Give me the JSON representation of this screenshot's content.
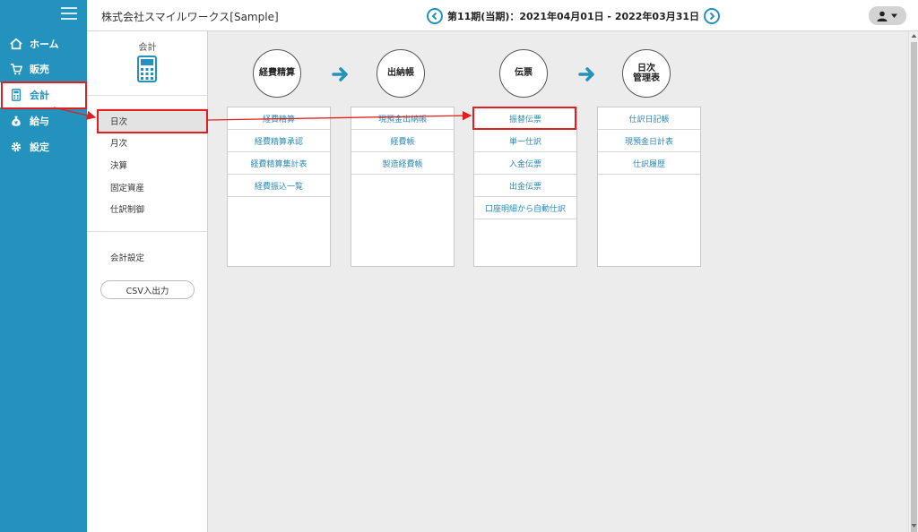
{
  "leftnav": {
    "items": [
      {
        "label": "ホーム",
        "icon": "home-icon"
      },
      {
        "label": "販売",
        "icon": "cart-icon"
      },
      {
        "label": "会計",
        "icon": "calculator-icon"
      },
      {
        "label": "給与",
        "icon": "money-bag-icon"
      },
      {
        "label": "設定",
        "icon": "gear-icon"
      }
    ],
    "active_index": 2
  },
  "header": {
    "company": "株式会社スマイルワークス[Sample]",
    "period": "第11期(当期)：2021年04月01日 - 2022年03月31日",
    "user_icon": "user-icon"
  },
  "submenu": {
    "title": "会計",
    "items": [
      "日次",
      "月次",
      "決算",
      "固定資産",
      "仕訳制御"
    ],
    "settings_label": "会計設定",
    "csv_button": "CSV入出力"
  },
  "flow": {
    "sections": [
      {
        "title": "経費精算",
        "items": [
          "経費精算",
          "経費精算承認",
          "経費精算集計表",
          "経費振込一覧"
        ]
      },
      {
        "title": "出納帳",
        "items": [
          "現預金出納帳",
          "経費帳",
          "製造経費帳"
        ]
      },
      {
        "title": "伝票",
        "items": [
          "振替伝票",
          "単一仕訳",
          "入金伝票",
          "出金伝票",
          "口座明細から自動仕訳"
        ]
      },
      {
        "title_line1": "日次",
        "title_line2": "管理表",
        "items": [
          "仕訳日記帳",
          "現預金日計表",
          "仕訳履歴"
        ]
      }
    ]
  },
  "colors": {
    "accent": "#2392bd",
    "highlight": "#e02020",
    "link": "#2a8ab5"
  }
}
